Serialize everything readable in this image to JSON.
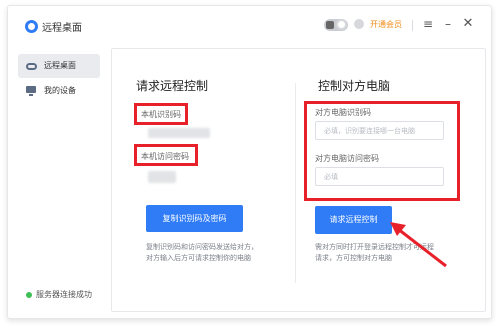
{
  "window": {
    "title": "远程桌面",
    "vip_label": "开通会员",
    "menu_icon": "≡",
    "minimize_icon": "–",
    "close_icon": "✕"
  },
  "sidebar": {
    "items": [
      {
        "label": "远程桌面",
        "icon": "link-icon",
        "active": true
      },
      {
        "label": "我的设备",
        "icon": "monitor-icon",
        "active": false
      }
    ],
    "status": "服务器连接成功",
    "status_color": "#3cbf55"
  },
  "left_panel": {
    "title": "请求远程控制",
    "id_label": "本机识别码",
    "password_label": "本机访问密码",
    "copy_button": "复制识别码及密码",
    "note_line1": "复制识别码和访问密码发送给对方，",
    "note_line2": "对方输入后方可请求控制你的电脑"
  },
  "right_panel": {
    "title": "控制对方电脑",
    "peer_id_label": "对方电脑识别码",
    "peer_id_placeholder": "必填，识别要连接哪一台电脑",
    "peer_password_label": "对方电脑访问密码",
    "peer_password_placeholder": "必填",
    "request_button": "请求远程控制",
    "note_line1": "需对方同时打开登录远程控制才可远程",
    "note_line2": "请求，方可控制对方电脑"
  },
  "colors": {
    "accent": "#2f7cf6",
    "highlight_box": "#e8202a",
    "vip": "#f08c1a"
  }
}
